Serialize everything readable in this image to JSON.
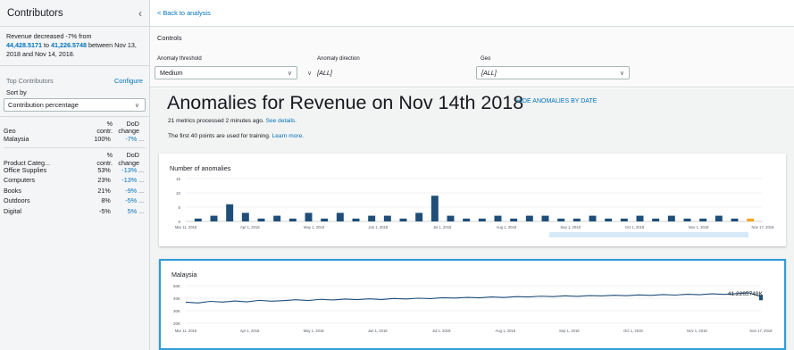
{
  "sidebar": {
    "title": "Contributors",
    "collapse_icon": "chevron-left-icon",
    "summary": {
      "prefix": "Revenue decreased -7% from",
      "from_value": "44,428.5171",
      "to_word": "to",
      "to_value": "41,226.5748",
      "suffix": "between Nov 13, 2018 and Nov 14, 2018."
    },
    "top_contributors_label": "Top Contributors",
    "configure_label": "Configure",
    "sort_by_label": "Sort by",
    "sort_by_value": "Contribution percentage",
    "groups": [
      {
        "header": [
          "",
          "%",
          "DoD"
        ],
        "header2": [
          "Geo",
          "contr.",
          "change"
        ],
        "rows": [
          {
            "name": "Malaysia",
            "contr": "100%",
            "change": "-7%",
            "more": "..."
          }
        ]
      },
      {
        "header": [
          "",
          "%",
          "DoD"
        ],
        "header2": [
          "Product Categ...",
          "contr.",
          "change"
        ],
        "rows": [
          {
            "name": "Office Supplies",
            "contr": "53%",
            "change": "-13%",
            "more": "..."
          },
          {
            "name": "Computers",
            "contr": "23%",
            "change": "-13%",
            "more": "..."
          },
          {
            "name": "Books",
            "contr": "21%",
            "change": "-9%",
            "more": "..."
          },
          {
            "name": "Outdoors",
            "contr": "8%",
            "change": "-5%",
            "more": "..."
          },
          {
            "name": "Digital",
            "contr": "-5%",
            "change": "5%",
            "more": "..."
          }
        ]
      }
    ]
  },
  "topbar": {
    "back_label": "< Back to analysis"
  },
  "controls": {
    "title": "Controls",
    "fields": [
      {
        "label": "Anomaly threshold",
        "value": "Medium"
      },
      {
        "label": "Anomaly direction",
        "value": "[ALL]"
      },
      {
        "label": "Geo",
        "value": "[ALL]"
      }
    ]
  },
  "content": {
    "headline": "Anomalies for Revenue on Nov 14th 2018",
    "hide_link": "HIDE ANOMALIES BY DATE",
    "meta1_text": "21 metrics processed 2 minutes ago.",
    "meta1_link": "See details.",
    "meta2_text": "The first 40 points are used for training.",
    "meta2_link": "Learn more."
  },
  "chart_data": [
    {
      "type": "bar",
      "title": "Number of anomalies",
      "ylim": [
        0,
        15
      ],
      "yticks": [
        "15",
        "10",
        "5",
        "0"
      ],
      "xticks": [
        "Mar 11, 2018",
        "Apr 1, 2018",
        "May 1, 2018",
        "Jun 1, 2018",
        "Jul 1, 2018",
        "Aug 1, 2018",
        "Sep 1, 2018",
        "Oct 1, 2018",
        "Nov 1, 2018",
        "Nov 17, 2018"
      ],
      "x": [
        "Mar 14",
        "Mar 21",
        "Mar 28",
        "Apr 4",
        "Apr 7",
        "Apr 14",
        "Apr 21",
        "May 2",
        "May 14",
        "Jun 1",
        "Jun 6",
        "Jun 14",
        "Jun 21",
        "Jun 28",
        "Jul 4",
        "Jul 7",
        "Jul 14",
        "Jul 21",
        "Jul 28",
        "Aug 3",
        "Aug 9",
        "Aug 14",
        "Aug 21",
        "Aug 28",
        "Sep 4",
        "Sep 11",
        "Sep 18",
        "Sep 25",
        "Oct 5",
        "Oct 12",
        "Oct 19",
        "Oct 26",
        "Nov 2",
        "Nov 9",
        "Nov 14",
        "Nov 17"
      ],
      "values": [
        1,
        2,
        6,
        3,
        1,
        2,
        1,
        3,
        1,
        3,
        1,
        2,
        2,
        1,
        3,
        9,
        2,
        1,
        1,
        2,
        1,
        2,
        2,
        1,
        1,
        2,
        1,
        1,
        2,
        1,
        2,
        1,
        1,
        2,
        1,
        1
      ],
      "bar_color": "#1f4e79",
      "highlight_color": "#f5a623"
    },
    {
      "type": "line",
      "title": "Malaysia",
      "ylim": [
        20000,
        50000
      ],
      "yticks": [
        "50K",
        "40K",
        "30K",
        "20K"
      ],
      "xticks": [
        "Mar 11, 2018",
        "Apr 1, 2018",
        "May 1, 2018",
        "Jun 1, 2018",
        "Jul 1, 2018",
        "Aug 1, 2018",
        "Sep 1, 2018",
        "Oct 1, 2018",
        "Nov 1, 2018",
        "Nov 17, 2018"
      ],
      "series": [
        {
          "values": [
            36800,
            36200,
            37500,
            36900,
            37800,
            37100,
            38300,
            37600,
            38100,
            38800,
            38200,
            39100,
            38600,
            39300,
            38900,
            39500,
            39000,
            39800,
            39400,
            40000,
            39700,
            40400,
            40100,
            40700,
            40300,
            41000,
            40600,
            41300,
            41000,
            41600,
            41300,
            41900,
            41500,
            42100,
            41800,
            42400,
            42000,
            42600,
            42300,
            42900,
            42500,
            43200,
            42800,
            43500,
            43100,
            43700,
            44428,
            41227
          ],
          "color": "#1f4e79"
        }
      ],
      "annotation": "41.2265748K"
    }
  ],
  "colors": {
    "link": "#0073bb",
    "bar": "#1f4e79",
    "selection": "#2e9cd8"
  }
}
